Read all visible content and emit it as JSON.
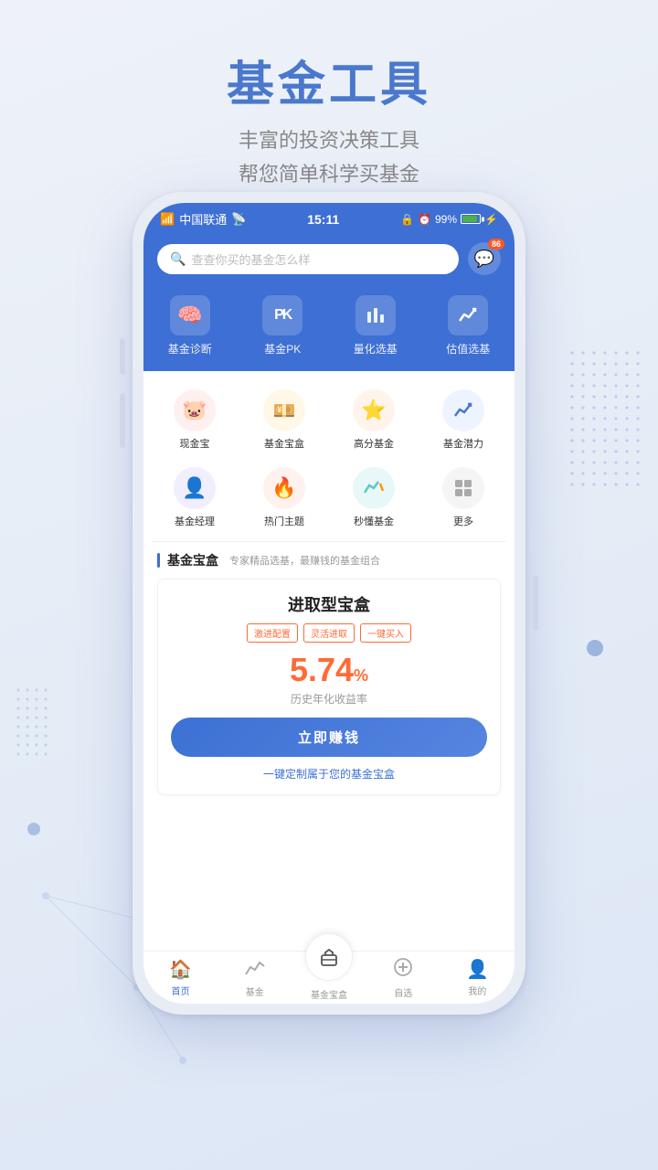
{
  "page": {
    "title": "基金工具",
    "subtitle_line1": "丰富的投资决策工具",
    "subtitle_line2": "帮您简单科学买基金"
  },
  "status_bar": {
    "carrier": "中国联通",
    "time": "15:11",
    "battery": "99%"
  },
  "search": {
    "placeholder": "查查你买的基金怎么样",
    "badge": "86"
  },
  "tools": [
    {
      "id": "fund-diagnosis",
      "label": "基金诊断",
      "icon": "🧠"
    },
    {
      "id": "fund-pk",
      "label": "基金PK",
      "icon": "PK"
    },
    {
      "id": "quant-select",
      "label": "量化选基",
      "icon": "📊"
    },
    {
      "id": "value-select",
      "label": "估值选基",
      "icon": "📈"
    }
  ],
  "icon_grid": [
    {
      "id": "cash-treasure",
      "label": "现金宝",
      "icon": "🐷",
      "color_class": "ic-pink"
    },
    {
      "id": "fund-box",
      "label": "基金宝盒",
      "icon": "💰",
      "color_class": "ic-yellow"
    },
    {
      "id": "high-score",
      "label": "高分基金",
      "icon": "⭐",
      "color_class": "ic-orange"
    },
    {
      "id": "fund-potential",
      "label": "基金潜力",
      "icon": "📈",
      "color_class": "ic-blue"
    },
    {
      "id": "fund-manager",
      "label": "基金经理",
      "icon": "👤",
      "color_class": "ic-purple"
    },
    {
      "id": "hot-topic",
      "label": "热门主题",
      "icon": "🔥",
      "color_class": "ic-redhot"
    },
    {
      "id": "quick-fund",
      "label": "秒懂基金",
      "icon": "📉",
      "color_class": "ic-teal"
    },
    {
      "id": "more",
      "label": "更多",
      "icon": "⋯",
      "color_class": "ic-gray"
    }
  ],
  "fund_box_section": {
    "title": "基金宝盒",
    "desc": "专家精品选基，最赚钱的基金组合",
    "card": {
      "name": "进取型宝盒",
      "tags": [
        "激进配置",
        "灵活进取",
        "一键买入"
      ],
      "rate": "5.74",
      "rate_unit": "%",
      "rate_label": "历史年化收益率",
      "button_label": "立即赚钱",
      "link_text": "一键定制属于您的基金宝盒"
    }
  },
  "bottom_nav": [
    {
      "id": "home",
      "label": "首页",
      "icon": "🏠",
      "active": true
    },
    {
      "id": "fund",
      "label": "基金",
      "icon": "📊",
      "active": false
    },
    {
      "id": "fund-box-nav",
      "label": "基金宝盒",
      "icon": "💼",
      "center": true
    },
    {
      "id": "watchlist",
      "label": "自选",
      "icon": "➕",
      "active": false
    },
    {
      "id": "mine",
      "label": "我的",
      "icon": "👤",
      "active": false
    }
  ]
}
